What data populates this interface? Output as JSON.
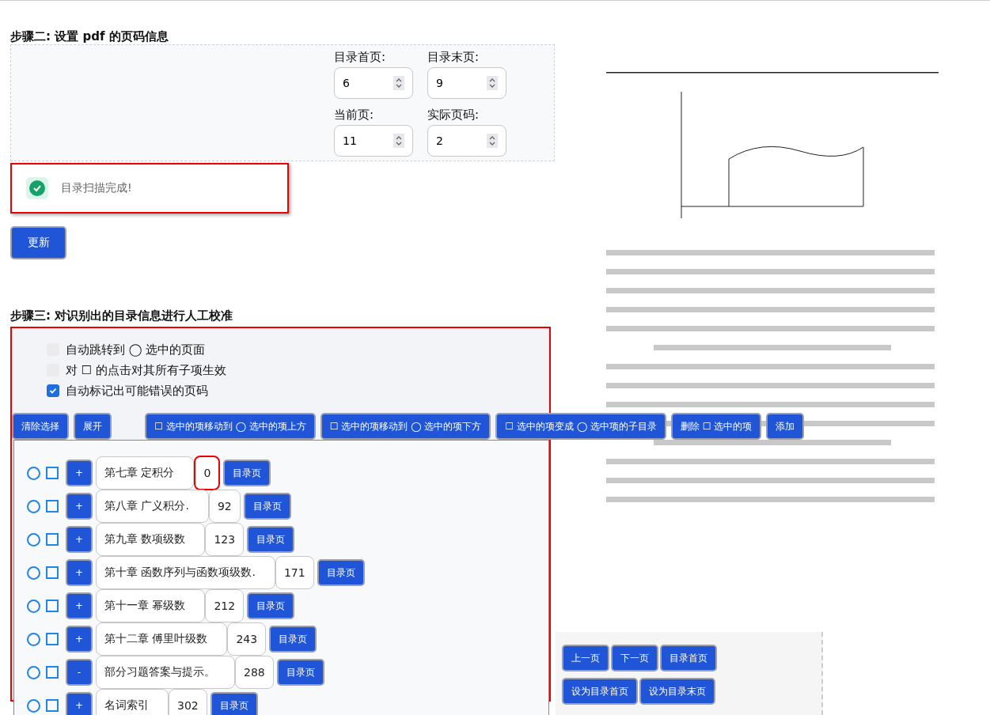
{
  "step2": {
    "heading": "步骤二: 设置 pdf 的页码信息",
    "fields": [
      {
        "label": "目录首页:",
        "value": "6"
      },
      {
        "label": "目录末页:",
        "value": "9"
      },
      {
        "label": "当前页:",
        "value": "11"
      },
      {
        "label": "实际页码:",
        "value": "2"
      }
    ],
    "alert": {
      "kind": "success",
      "text": "目录扫描完成!"
    },
    "update_button": "更新"
  },
  "step3": {
    "heading": "步骤三: 对识别出的目录信息进行人工校准",
    "options": [
      {
        "label": "自动跳转到 ◯ 选中的页面",
        "checked": false,
        "disabled": true
      },
      {
        "label": "对 ☐ 的点击对其所有子项生效",
        "checked": false,
        "disabled": true
      },
      {
        "label": "自动标记出可能错误的页码",
        "checked": true,
        "disabled": false
      }
    ],
    "toolbar": [
      "清除选择",
      "展开",
      "☐ 选中的项移动到 ◯ 选中的项上方",
      "☐ 选中的项移动到 ◯ 选中的项下方",
      "☐ 选中的项变成 ◯ 选中项的子目录",
      "删除 ☐ 选中的项",
      "添加"
    ],
    "entries": [
      {
        "selected": false,
        "checked": false,
        "toggle": "+",
        "title": "第七章 定积分",
        "page": "0",
        "flagged": true,
        "button": "目录页"
      },
      {
        "selected": false,
        "checked": false,
        "toggle": "+",
        "title": "第八章 广义积分.",
        "page": "92",
        "flagged": false,
        "button": "目录页"
      },
      {
        "selected": false,
        "checked": false,
        "toggle": "+",
        "title": "第九章 数项级数",
        "page": "123",
        "flagged": false,
        "button": "目录页"
      },
      {
        "selected": false,
        "checked": false,
        "toggle": "+",
        "title": "第十章 函数序列与函数项级数.",
        "page": "171",
        "flagged": false,
        "button": "目录页"
      },
      {
        "selected": false,
        "checked": false,
        "toggle": "+",
        "title": "第十一章 幂级数",
        "page": "212",
        "flagged": false,
        "button": "目录页"
      },
      {
        "selected": false,
        "checked": false,
        "toggle": "+",
        "title": "第十二章 傅里叶级数",
        "page": "243",
        "flagged": false,
        "button": "目录页"
      },
      {
        "selected": false,
        "checked": false,
        "toggle": "-",
        "title": "部分习题答案与提示。",
        "page": "288",
        "flagged": false,
        "button": "目录页"
      },
      {
        "selected": false,
        "checked": false,
        "toggle": "+",
        "title": "名词索引",
        "page": "302",
        "flagged": false,
        "button": "目录页"
      }
    ]
  },
  "viewer": {
    "nav_buttons": [
      [
        "上一页",
        "下一页",
        "目录首页"
      ],
      [
        "设为目录首页",
        "设为目录末页"
      ]
    ]
  }
}
